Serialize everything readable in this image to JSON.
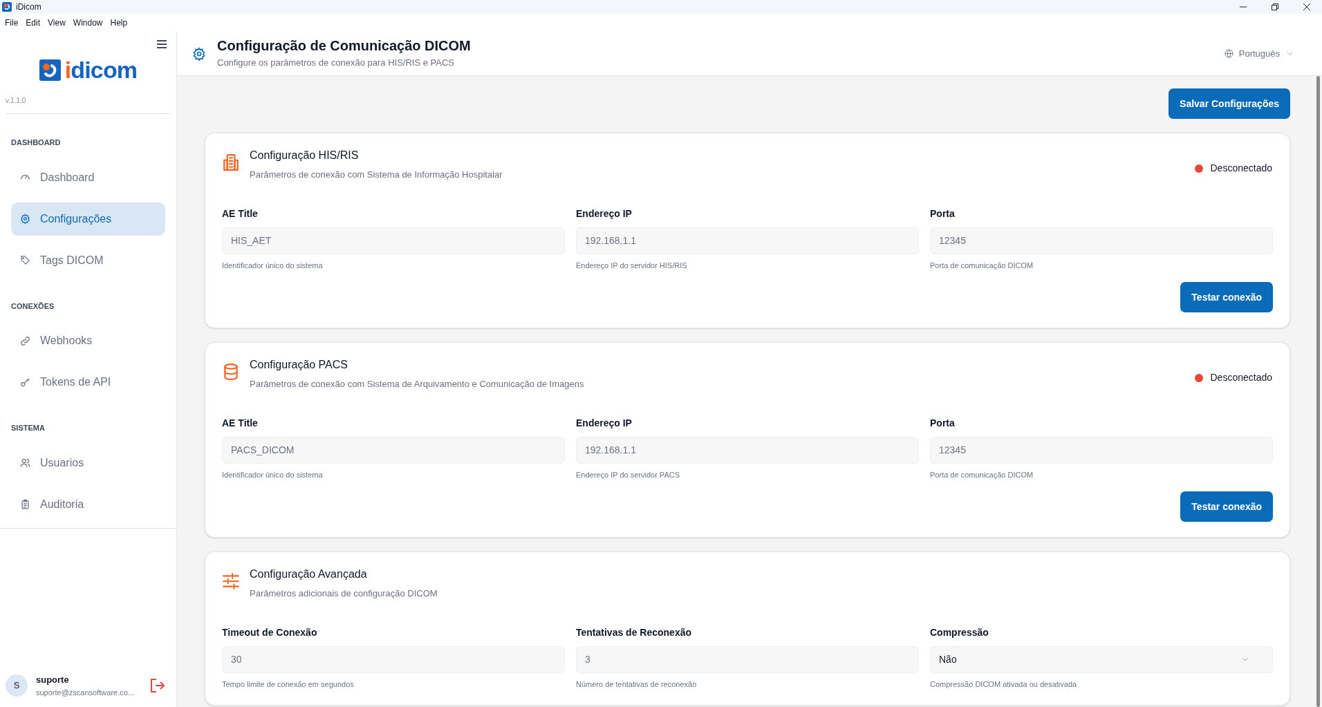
{
  "window": {
    "title": "iDicom"
  },
  "menu": [
    "File",
    "Edit",
    "View",
    "Window",
    "Help"
  ],
  "sidebar": {
    "logo_text": "idicom",
    "version": "v.1.1.0",
    "sections": [
      {
        "heading": "DASHBOARD",
        "items": [
          {
            "label": "Dashboard",
            "selected": false
          },
          {
            "label": "Configurações",
            "selected": true
          },
          {
            "label": "Tags DICOM",
            "selected": false
          }
        ]
      },
      {
        "heading": "CONEXÕES",
        "items": [
          {
            "label": "Webhooks",
            "selected": false
          },
          {
            "label": "Tokens de API",
            "selected": false
          }
        ]
      },
      {
        "heading": "SISTEMA",
        "items": [
          {
            "label": "Usuarios",
            "selected": false
          },
          {
            "label": "Auditoria",
            "selected": false
          }
        ]
      }
    ],
    "user": {
      "initial": "S",
      "name": "suporte",
      "email": "suporte@zscansoftware.co..."
    }
  },
  "header": {
    "title": "Configuração de Comunicação DICOM",
    "subtitle": "Configure os parâmetros de conexão para HIS/RIS e PACS",
    "language": "Português"
  },
  "save_button": "Salvar Configurações",
  "cards": [
    {
      "title": "Configuração HIS/RIS",
      "subtitle": "Parâmetros de conexão com Sistema de Informação Hospitalar",
      "status": {
        "label": "Desconectado",
        "color": "#e5483b"
      },
      "fields": [
        {
          "kind": "input",
          "label": "AE Title",
          "value": "HIS_AET",
          "hint": "Identificador único do sistema"
        },
        {
          "kind": "input",
          "label": "Endereço IP",
          "value": "192.168.1.1",
          "hint": "Endereço IP do servidor HIS/RIS"
        },
        {
          "kind": "input",
          "label": "Porta",
          "value": "12345",
          "hint": "Porta de comunicação DICOM"
        }
      ],
      "button": "Testar conexão"
    },
    {
      "title": "Configuração PACS",
      "subtitle": "Parâmetros de conexão com Sistema de Arquivamento e Comunicação de Imagens",
      "status": {
        "label": "Desconectado",
        "color": "#e5483b"
      },
      "fields": [
        {
          "kind": "input",
          "label": "AE Title",
          "value": "PACS_DICOM",
          "hint": "Identificador único do sistema"
        },
        {
          "kind": "input",
          "label": "Endereço IP",
          "value": "192.168.1.1",
          "hint": "Endereço IP do servidor PACS"
        },
        {
          "kind": "input",
          "label": "Porta",
          "value": "12345",
          "hint": "Porta de comunicação DICOM"
        }
      ],
      "button": "Testar conexão"
    },
    {
      "title": "Configuração Avançada",
      "subtitle": "Parâmetros adicionais de configuração DICOM",
      "fields": [
        {
          "kind": "input",
          "label": "Timeout de Conexão",
          "value": "30",
          "hint": "Tempo limite de conexão em segundos"
        },
        {
          "kind": "input",
          "label": "Tentativas de Reconexão",
          "value": "3",
          "hint": "Número de tentativas de reconexão"
        },
        {
          "kind": "select",
          "label": "Compressão",
          "value": "Não",
          "hint": "Compressão DICOM ativada ou desativada"
        }
      ]
    }
  ]
}
